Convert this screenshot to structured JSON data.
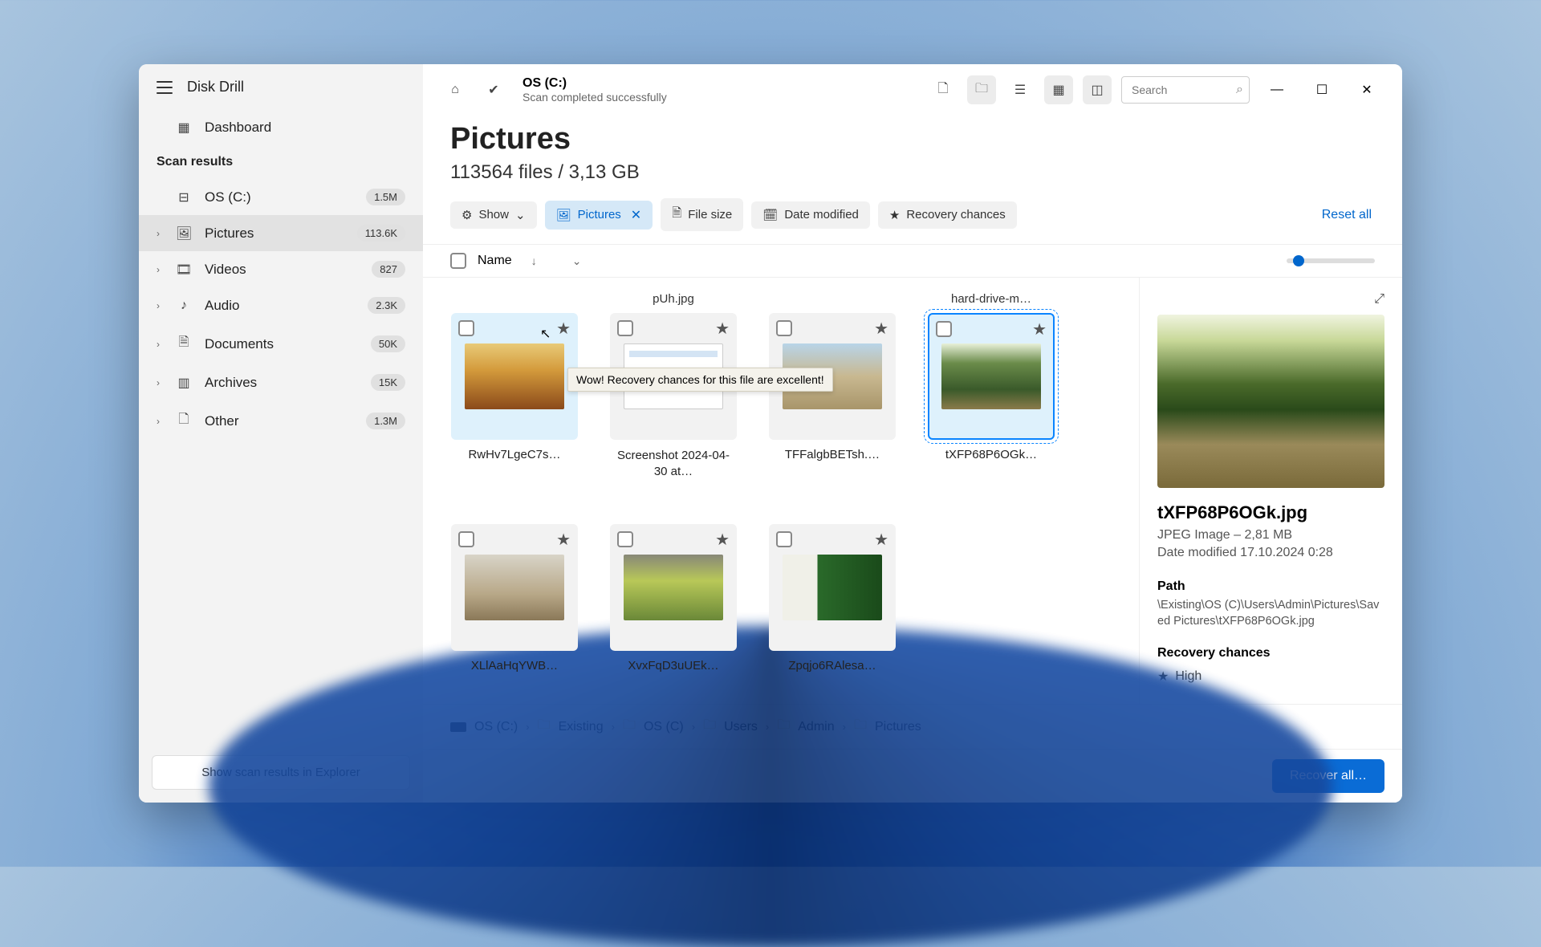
{
  "app": {
    "title": "Disk Drill"
  },
  "sidebar": {
    "dashboard": "Dashboard",
    "section": "Scan results",
    "items": [
      {
        "label": "OS (C:)",
        "badge": "1.5M"
      },
      {
        "label": "Pictures",
        "badge": "113.6K"
      },
      {
        "label": "Videos",
        "badge": "827"
      },
      {
        "label": "Audio",
        "badge": "2.3K"
      },
      {
        "label": "Documents",
        "badge": "50K"
      },
      {
        "label": "Archives",
        "badge": "15K"
      },
      {
        "label": "Other",
        "badge": "1.3M"
      }
    ],
    "footer_btn": "Show scan results in Explorer"
  },
  "toolbar": {
    "title": "OS (C:)",
    "subtitle": "Scan completed successfully",
    "search_placeholder": "Search"
  },
  "header": {
    "title": "Pictures",
    "subtitle": "113564 files / 3,13 GB"
  },
  "filters": {
    "show": "Show",
    "pictures": "Pictures",
    "filesize": "File size",
    "datemod": "Date modified",
    "recovery": "Recovery chances",
    "reset": "Reset all"
  },
  "list": {
    "name_col": "Name"
  },
  "tooltip": "Wow! Recovery chances for this file are excellent!",
  "thumbs": [
    {
      "top": "",
      "bottom": "RwHv7LgeC7s…"
    },
    {
      "top": "pUh.jpg",
      "bottom": "Screenshot 2024-04-30 at…"
    },
    {
      "top": "",
      "bottom": "TFFalgbBETsh.…"
    },
    {
      "top": "hard-drive-m…",
      "bottom": "tXFP68P6OGk…"
    },
    {
      "top": "",
      "bottom": "XLlAaHqYWB…"
    },
    {
      "top": "",
      "bottom": "XvxFqD3uUEk…"
    },
    {
      "top": "",
      "bottom": "Zpqjo6RAlesa…"
    }
  ],
  "preview": {
    "name": "tXFP68P6OGk.jpg",
    "meta1": "JPEG Image – 2,81 MB",
    "meta2": "Date modified 17.10.2024 0:28",
    "path_label": "Path",
    "path": "\\Existing\\OS (C)\\Users\\Admin\\Pictures\\Saved Pictures\\tXFP68P6OGk.jpg",
    "recov_label": "Recovery chances",
    "recov_value": "High"
  },
  "breadcrumb": [
    "OS (C:)",
    "Existing",
    "OS (C)",
    "Users",
    "Admin",
    "Pictures"
  ],
  "footer": {
    "recover": "Recover all…"
  }
}
